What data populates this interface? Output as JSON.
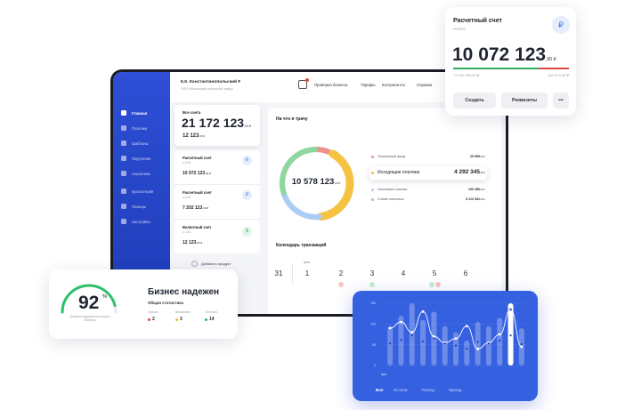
{
  "sidebar": {
    "items": [
      {
        "label": "Главная",
        "icon": "grid-icon",
        "active": true
      },
      {
        "label": "Платежи",
        "icon": "card-icon",
        "active": false
      },
      {
        "label": "Шаблоны",
        "icon": "star-icon",
        "active": false
      },
      {
        "label": "Поручения",
        "icon": "calendar-icon",
        "active": false
      },
      {
        "label": "Аналитика",
        "icon": "chart-icon",
        "active": false
      },
      {
        "label": "Бухгалтерия",
        "icon": "ledger-icon",
        "active": false
      },
      {
        "label": "Помощь",
        "icon": "help-icon",
        "active": false
      },
      {
        "label": "Настройки",
        "icon": "gear-icon",
        "active": false
      }
    ]
  },
  "header": {
    "user": "К.К. Константинопольский ▾",
    "company": "ООО «Московский розничный завод»",
    "nav": [
      "Проверка бизнеса",
      "Тарифы",
      "Контрагенты",
      "Справка"
    ]
  },
  "accounts": {
    "total": {
      "title": "Все счета",
      "amount": "21 172 123",
      "amount_cents": ",00 ₽",
      "sub_amount": "12 123",
      "sub_cents": ",00 $"
    },
    "items": [
      {
        "title": "Расчетный счет",
        "sub": "••1234",
        "amount": "10 072 123",
        "cents": ",00 ₽",
        "badge": "₽",
        "badge_color": "#3f6fe0"
      },
      {
        "title": "Расчетный счет",
        "sub": "••1234",
        "amount": "7 202 123",
        "cents": ",00 ₽",
        "badge": "₽",
        "badge_color": "#3f6fe0"
      },
      {
        "title": "Валютный счет",
        "sub": "••1234",
        "amount": "12 123",
        "cents": ",00 $",
        "badge": "$",
        "badge_color": "#2eae5e"
      }
    ],
    "add_product": "Добавить продукт"
  },
  "spending": {
    "title": "На что я трачу",
    "center_amount": "10 578 123",
    "center_cents": ",00 ₽",
    "segments": [
      {
        "label": "Пенсионный фонд",
        "value": "25 555",
        "cents": ",00 ₽",
        "color": "#f08f8f",
        "share": 0.08
      },
      {
        "label": "Исходящие платежи",
        "value": "4 292 345",
        "cents": ",00 ₽",
        "color": "#f5c242",
        "share": 0.4
      },
      {
        "label": "Налоговые платежи",
        "value": "100 456",
        "cents": ",00 ₽",
        "color": "#a9cdf5",
        "share": 0.22
      },
      {
        "label": "Снятие наличных",
        "value": "6 212 941",
        "cents": ",00 ₽",
        "color": "#8ed79f",
        "share": 0.3
      }
    ]
  },
  "calendar": {
    "title": "Календарь транзакций",
    "month_label": "фев",
    "days": [
      "31",
      "1",
      "2",
      "3",
      "4",
      "5",
      "6"
    ]
  },
  "account_card": {
    "title": "Расчетный счет",
    "sub": "••1234",
    "badge": "₽",
    "amount": "10 072 123",
    "cents": ",00 ₽",
    "income": "+1 100 456,00 ₽",
    "outcome": "-342 673,00 ₽",
    "buttons": [
      "Создать",
      "Реквизиты",
      "•••"
    ]
  },
  "health_card": {
    "percent": "92",
    "percent_sign": "%",
    "gauge_value": 0.92,
    "gauge_caption": "Уровень надежности вашего бизнеса",
    "title": "Бизнес надежен",
    "subtitle": "Общая статистика",
    "stats": [
      {
        "label": "Угрозы",
        "value": "2",
        "color": "#e0473f"
      },
      {
        "label": "Внимание",
        "value": "3",
        "color": "#f5b82e"
      },
      {
        "label": "Отлично",
        "value": "14",
        "color": "#2eae5e"
      }
    ]
  },
  "chart_card": {
    "y_ticks": [
      "150",
      "100",
      "50",
      "0"
    ],
    "x_month": "фев",
    "tabs": [
      "Все",
      "Остаток",
      "Расход",
      "Приход"
    ]
  },
  "chart_data": {
    "type": "bar",
    "categories": [
      "1",
      "2",
      "3",
      "4",
      "5",
      "6",
      "7",
      "8",
      "9",
      "10",
      "11",
      "12",
      "13"
    ],
    "series": [
      {
        "values": [
          95,
          120,
          150,
          110,
          130,
          95,
          80,
          60,
          105,
          95,
          115,
          150,
          90
        ]
      },
      {
        "values": [
          90,
          105,
          80,
          130,
          70,
          55,
          65,
          95,
          40,
          55,
          75,
          135,
          45
        ]
      }
    ],
    "ylim": [
      0,
      150
    ]
  }
}
